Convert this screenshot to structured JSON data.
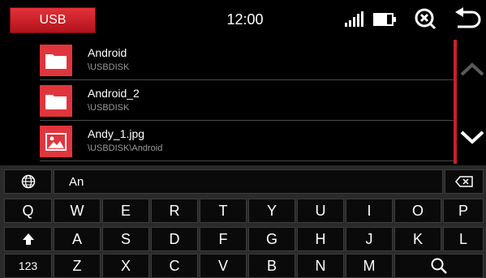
{
  "header": {
    "tab_label": "USB",
    "clock": "12:00",
    "icons": [
      "signal-icon",
      "battery-icon",
      "cancel-search-icon",
      "back-icon"
    ],
    "accent_color": "#e0353d"
  },
  "files": [
    {
      "name": "Android",
      "path": "\\USBDISK",
      "type": "folder"
    },
    {
      "name": "Android_2",
      "path": "\\USBDISK",
      "type": "folder"
    },
    {
      "name": "Andy_1.jpg",
      "path": "\\USBDISK\\Android",
      "type": "image"
    }
  ],
  "keyboard": {
    "input_value": "An",
    "row1": [
      "Q",
      "W",
      "E",
      "R",
      "T",
      "Y",
      "U",
      "I",
      "O",
      "P"
    ],
    "row2": [
      "A",
      "S",
      "D",
      "F",
      "G",
      "H",
      "J",
      "K",
      "L"
    ],
    "row3": [
      "Z",
      "X",
      "C",
      "V",
      "B",
      "N",
      "M"
    ],
    "numbers_label": "123"
  }
}
